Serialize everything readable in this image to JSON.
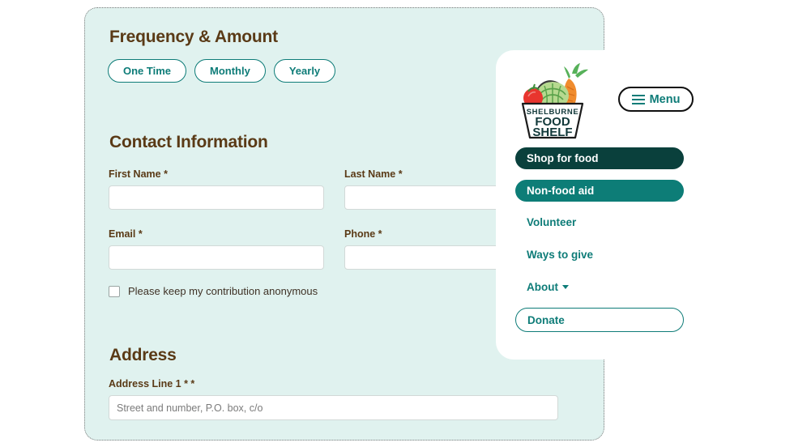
{
  "colors": {
    "form_background": "#e0f2ef",
    "heading_brown": "#5a3a16",
    "teal_primary": "#0e7c78",
    "teal_dark": "#0a403c",
    "teal_mid": "#0d7d77",
    "panel_white": "#ffffff",
    "input_border": "#d2d9d7"
  },
  "form": {
    "frequency": {
      "title": "Frequency & Amount",
      "options": [
        {
          "label": "One Time"
        },
        {
          "label": "Monthly"
        },
        {
          "label": "Yearly"
        }
      ]
    },
    "contact": {
      "title": "Contact Information",
      "fields": [
        {
          "label": "First Name *",
          "value": "",
          "placeholder": ""
        },
        {
          "label": "Last Name *",
          "value": "",
          "placeholder": ""
        },
        {
          "label": "Email *",
          "value": "",
          "placeholder": ""
        },
        {
          "label": "Phone *",
          "value": "",
          "placeholder": ""
        }
      ],
      "anonymous": {
        "label": "Please keep my contribution anonymous",
        "checked": false
      }
    },
    "address": {
      "title": "Address",
      "line1": {
        "label": "Address Line 1 * *",
        "value": "",
        "placeholder": "Street and number, P.O. box, c/o"
      }
    }
  },
  "nav_panel": {
    "logo": {
      "icon": "grocery-basket-icon",
      "line1": "SHELBURNE",
      "line2": "FOOD",
      "line3": "SHELF"
    },
    "menu_button": {
      "label": "Menu",
      "icon": "hamburger-icon"
    },
    "items": [
      {
        "label": "Shop for food",
        "style": "solid-dark",
        "caret": false
      },
      {
        "label": "Non-food aid",
        "style": "solid-mid",
        "caret": false
      },
      {
        "label": "Volunteer",
        "style": "plain",
        "caret": false
      },
      {
        "label": "Ways to give",
        "style": "plain",
        "caret": false
      },
      {
        "label": "About",
        "style": "plain",
        "caret": true
      },
      {
        "label": "Donate",
        "style": "outline",
        "caret": false
      }
    ]
  }
}
